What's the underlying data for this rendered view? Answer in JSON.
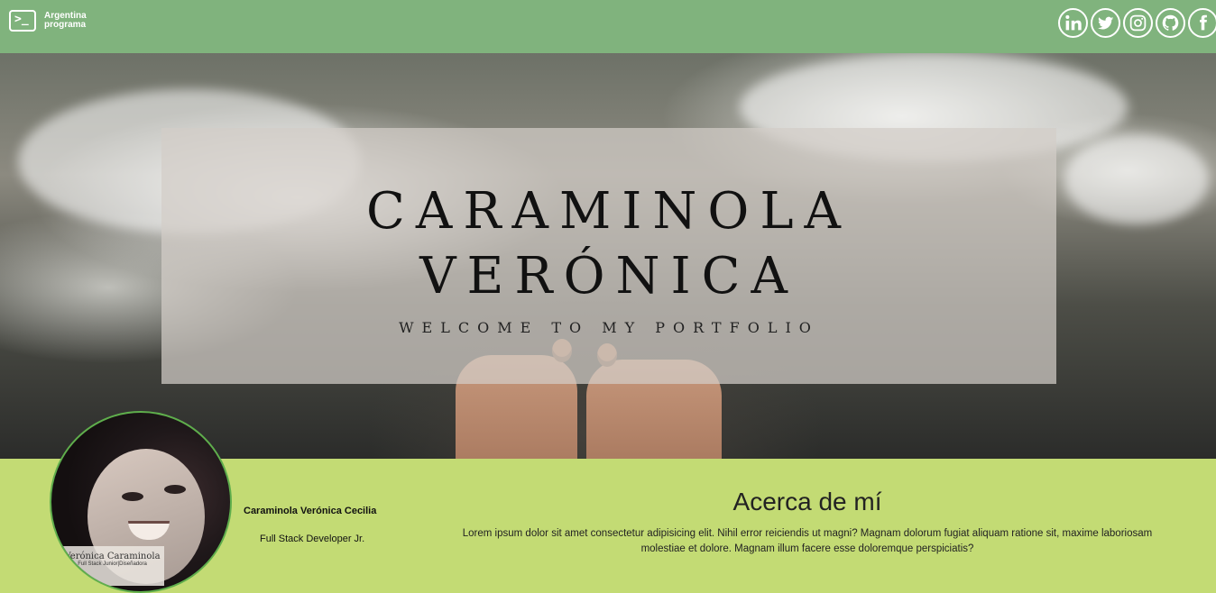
{
  "header": {
    "brand_text": "Argentina\nprograma",
    "socials": [
      {
        "name": "linkedin"
      },
      {
        "name": "twitter"
      },
      {
        "name": "instagram"
      },
      {
        "name": "github"
      },
      {
        "name": "facebook"
      }
    ]
  },
  "hero": {
    "title_line1": "Caraminola",
    "title_line2": "Verónica",
    "subtitle": "Welcome to my portfolio"
  },
  "profile": {
    "avatar_caption_name": "Verónica Caraminola",
    "avatar_caption_role": "Full Stack Junior|Diseñadora",
    "name": "Caraminola Verónica Cecilia",
    "role": "Full Stack Developer Jr."
  },
  "about": {
    "title": "Acerca de mí",
    "text": "Lorem ipsum dolor sit amet consectetur adipisicing elit. Nihil error reiciendis ut magni? Magnam dolorum fugiat aliquam ratione sit, maxime laboriosam molestiae et dolore. Magnam illum facere esse doloremque perspiciatis?"
  },
  "colors": {
    "header_bg": "#80b37d",
    "section_bg": "#c3db74"
  }
}
